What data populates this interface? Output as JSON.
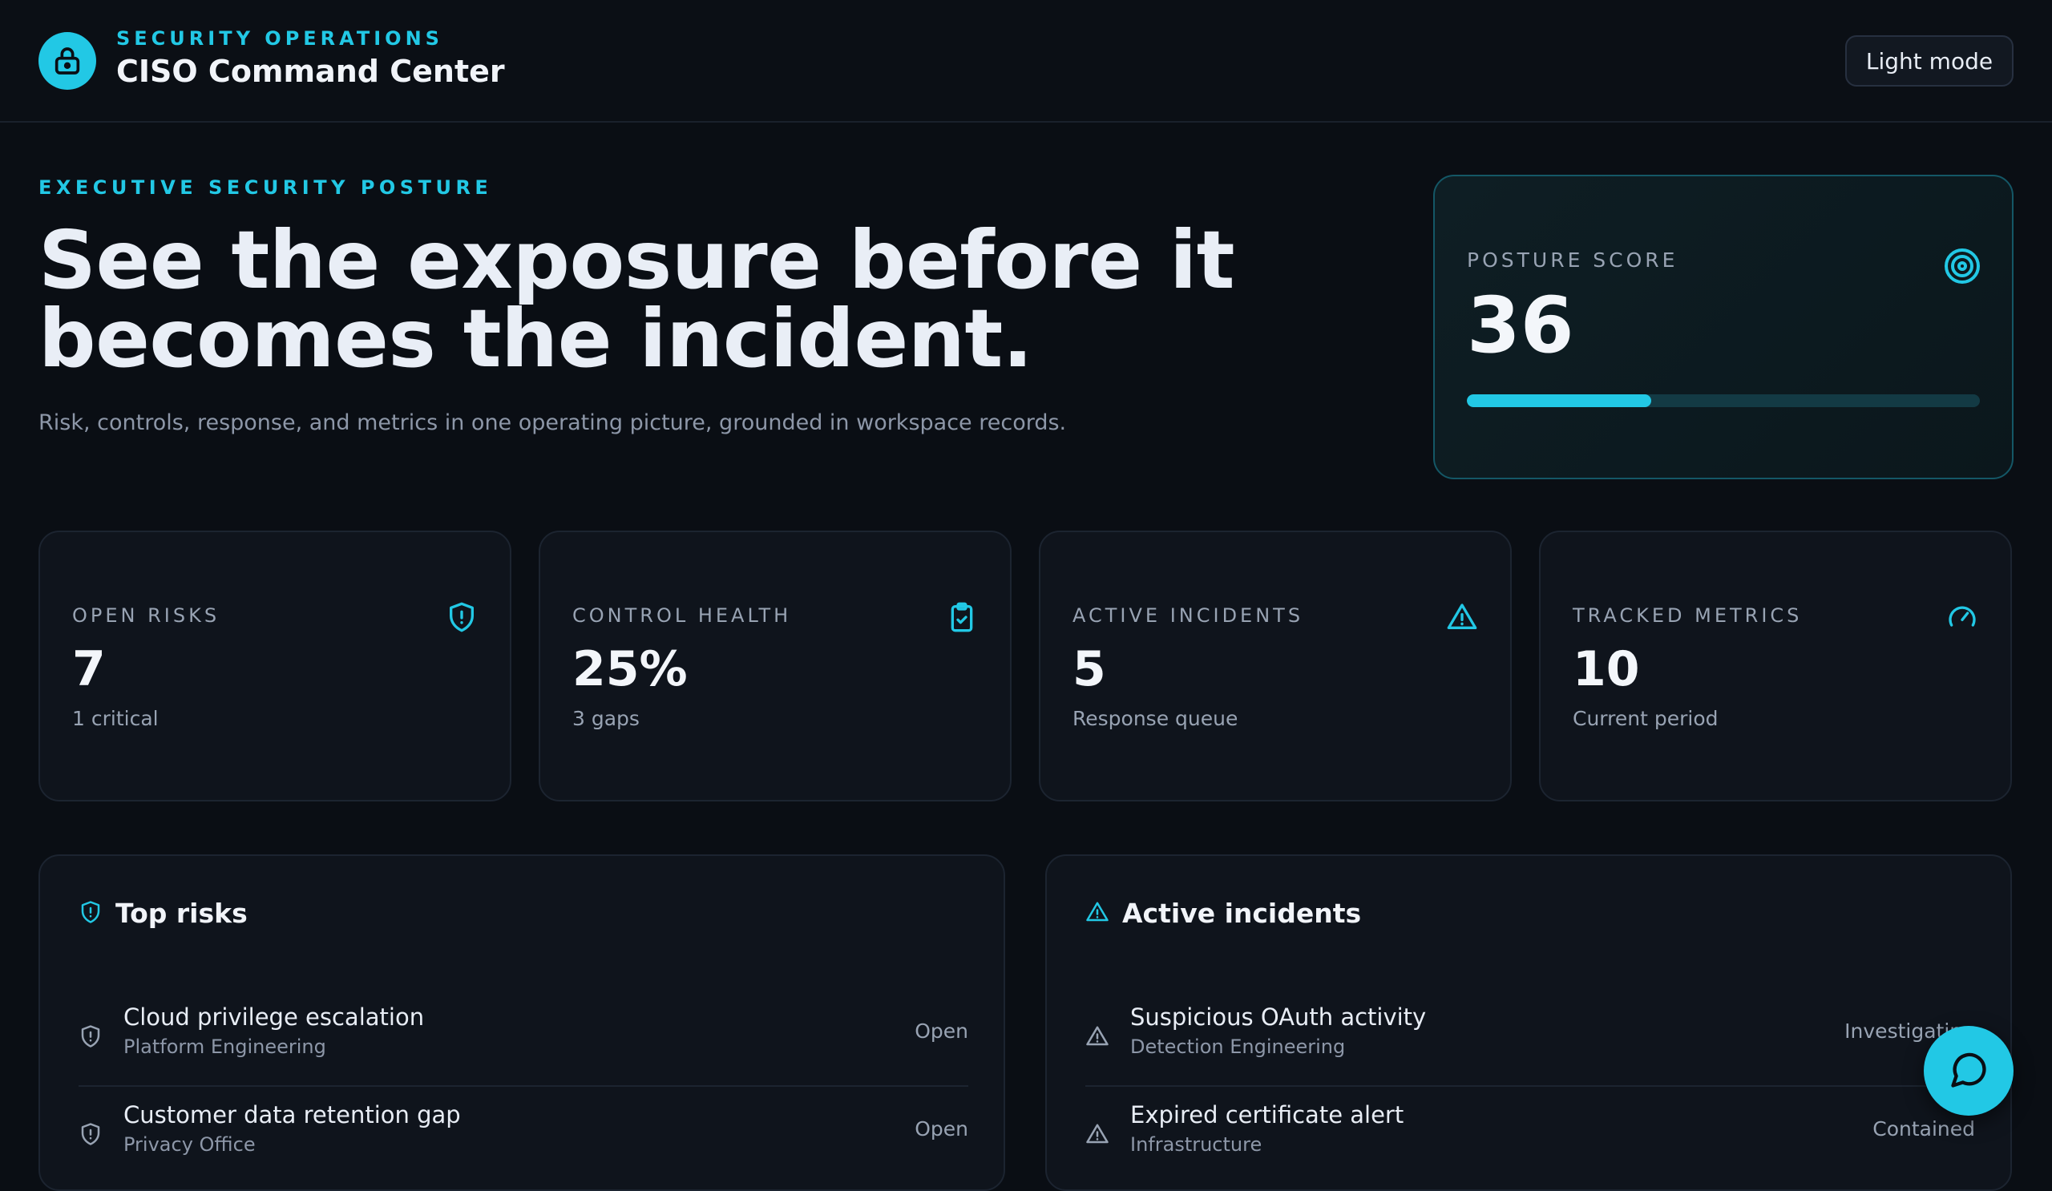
{
  "header": {
    "eyebrow": "SECURITY OPERATIONS",
    "title": "CISO Command Center",
    "mode_button": "Light mode"
  },
  "hero": {
    "eyebrow": "EXECUTIVE SECURITY POSTURE",
    "title": "See the exposure before it becomes the incident.",
    "subtitle": "Risk, controls, response, and metrics in one operating picture, grounded in workspace records."
  },
  "posture": {
    "label": "POSTURE SCORE",
    "value": "36",
    "progress_percent": 36,
    "icon": "target-icon"
  },
  "stats": [
    {
      "label": "OPEN RISKS",
      "value": "7",
      "sub": "1 critical",
      "icon": "shield-alert-icon"
    },
    {
      "label": "CONTROL HEALTH",
      "value": "25%",
      "sub": "3 gaps",
      "icon": "clipboard-check-icon"
    },
    {
      "label": "ACTIVE INCIDENTS",
      "value": "5",
      "sub": "Response queue",
      "icon": "alert-triangle-icon"
    },
    {
      "label": "TRACKED METRICS",
      "value": "10",
      "sub": "Current period",
      "icon": "gauge-icon"
    }
  ],
  "top_risks": {
    "title": "Top risks",
    "items": [
      {
        "title": "Cloud privilege escalation",
        "owner": "Platform Engineering",
        "status": "Open"
      },
      {
        "title": "Customer data retention gap",
        "owner": "Privacy Office",
        "status": "Open"
      }
    ]
  },
  "active_incidents": {
    "title": "Active incidents",
    "items": [
      {
        "title": "Suspicious OAuth activity",
        "owner": "Detection Engineering",
        "status": "Investigating"
      },
      {
        "title": "Expired certificate alert",
        "owner": "Infrastructure",
        "status": "Contained"
      }
    ]
  },
  "colors": {
    "accent": "#22c8e5",
    "background": "#0a0e14",
    "card": "#0f141c"
  }
}
